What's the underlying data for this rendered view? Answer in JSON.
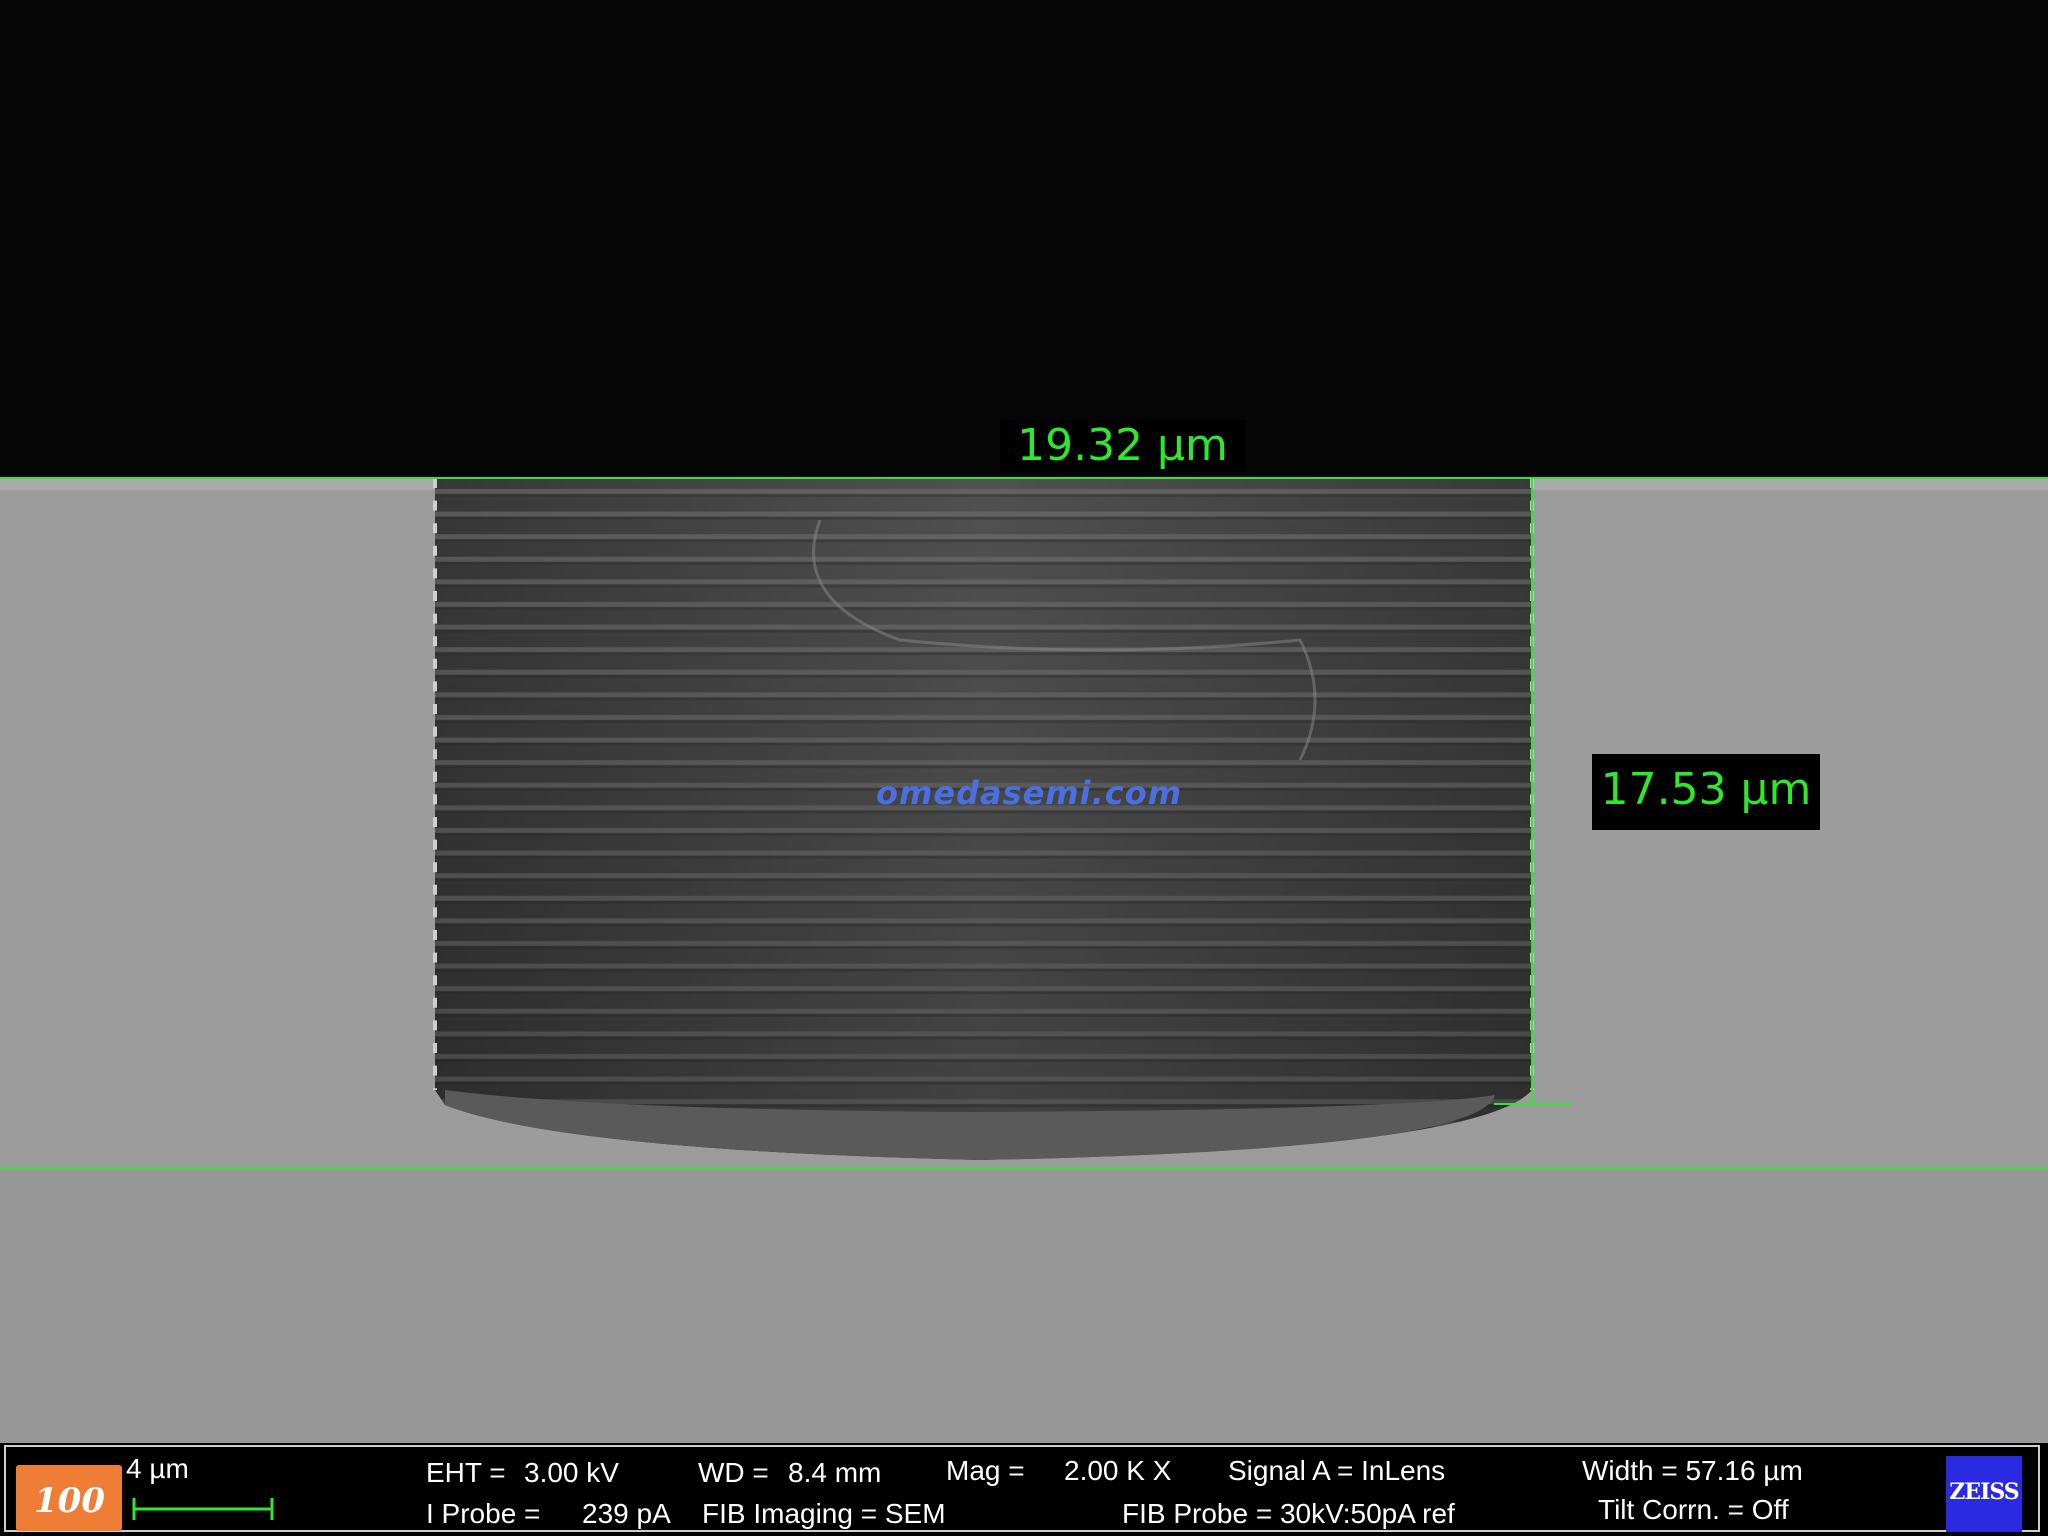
{
  "measurements": {
    "width_label": "19.32 µm",
    "depth_label": "17.53 µm",
    "line_color": "#2ee82e"
  },
  "watermark": "omedasemi.com",
  "info_bar": {
    "scale": "4 µm",
    "eht_label": "EHT =",
    "eht_value": "3.00 kV",
    "iprobe_label": "I Probe =",
    "iprobe_value": "239 pA",
    "wd_label": "WD =",
    "wd_value": "8.4 mm",
    "fib_imaging": "FIB Imaging = SEM",
    "mag_label": "Mag =",
    "mag_value": "2.00 K X",
    "signal": "Signal A = InLens",
    "fib_probe": "FIB Probe = 30kV:50pA ref",
    "width": "Width = 57.16 µm",
    "tilt": "Tilt Corrn. = Off",
    "zeiss": "ZEISS"
  }
}
